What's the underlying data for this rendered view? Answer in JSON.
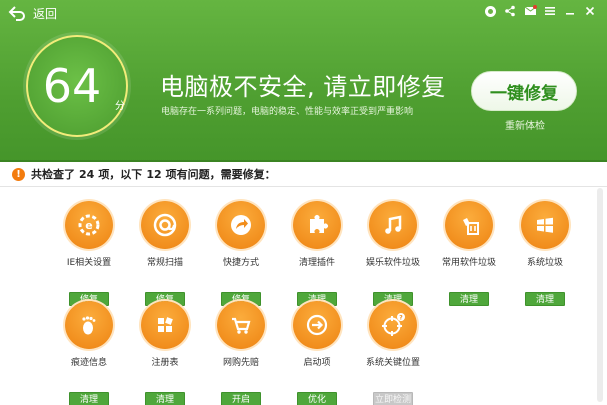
{
  "header": {
    "back_label": "返回",
    "score": "64",
    "score_unit": "分",
    "headline": "电脑极不安全, 请立即修复",
    "subline": "电脑存在一系列问题，电脑的稳定、性能与效率正受到严重影响",
    "fix_button": "一键修复",
    "recheck_link": "重新体检",
    "brand_color": "#55a636"
  },
  "summary": {
    "prefix": "共检查了",
    "total": "24",
    "mid": "项，以下",
    "problems": "12",
    "suffix": "项有问题，需要修复：",
    "unit": "项"
  },
  "items": [
    {
      "label": "IE相关设置",
      "action": "修复",
      "icon": "ie-gear-icon"
    },
    {
      "label": "常规扫描",
      "action": "修复",
      "icon": "scan-icon"
    },
    {
      "label": "快捷方式",
      "action": "修复",
      "icon": "shortcut-icon"
    },
    {
      "label": "清理插件",
      "action": "清理",
      "icon": "puzzle-icon"
    },
    {
      "label": "娱乐软件垃圾",
      "action": "清理",
      "icon": "music-icon"
    },
    {
      "label": "常用软件垃圾",
      "action": "清理",
      "icon": "software-trash-icon"
    },
    {
      "label": "系统垃圾",
      "action": "清理",
      "icon": "windows-icon"
    },
    {
      "label": "痕迹信息",
      "action": "清理",
      "icon": "footprint-icon"
    },
    {
      "label": "注册表",
      "action": "清理",
      "icon": "registry-icon"
    },
    {
      "label": "网购先赔",
      "action": "开启",
      "icon": "cart-icon"
    },
    {
      "label": "启动项",
      "action": "优化",
      "icon": "startup-icon"
    },
    {
      "label": "系统关键位置",
      "action": "立即检测",
      "icon": "target-icon"
    }
  ]
}
